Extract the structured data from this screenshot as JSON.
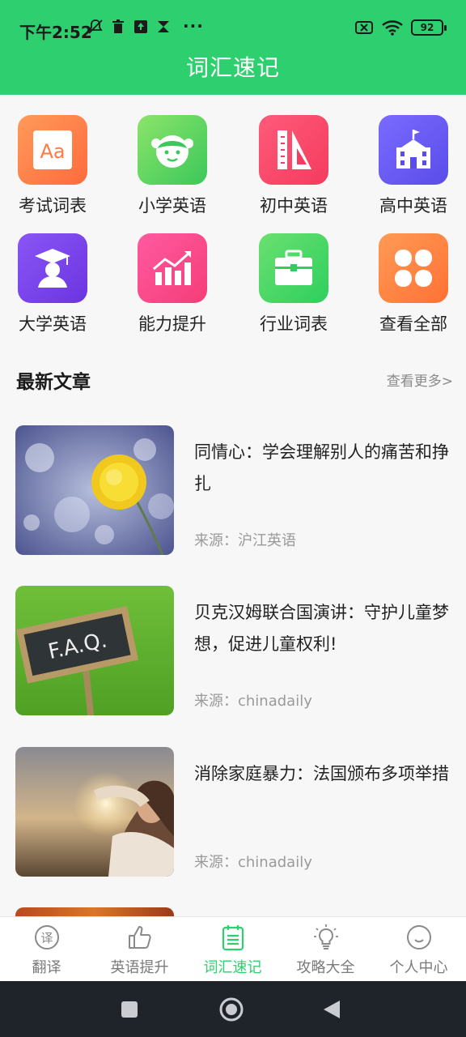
{
  "status": {
    "time": "下午2:52",
    "dots": "···",
    "battery": "92"
  },
  "header": {
    "title": "词汇速记"
  },
  "categories": [
    {
      "label": "考试词表",
      "icon": "aa-letters-icon",
      "color1": "#ff9a5a",
      "color2": "#ff6b3d"
    },
    {
      "label": "小学英语",
      "icon": "child-face-icon",
      "color1": "#8be46a",
      "color2": "#3cc85a"
    },
    {
      "label": "初中英语",
      "icon": "ruler-triangle-icon",
      "color1": "#ff5a7a",
      "color2": "#f43c5e"
    },
    {
      "label": "高中英语",
      "icon": "school-building-icon",
      "color1": "#7a6bff",
      "color2": "#5a4ce8"
    },
    {
      "label": "大学英语",
      "icon": "graduate-icon",
      "color1": "#8a55f5",
      "color2": "#6a35e0"
    },
    {
      "label": "能力提升",
      "icon": "growth-chart-icon",
      "color1": "#ff5aa0",
      "color2": "#f53d78"
    },
    {
      "label": "行业词表",
      "icon": "toolbox-icon",
      "color1": "#6ae070",
      "color2": "#2ecf5e"
    },
    {
      "label": "查看全部",
      "icon": "four-petal-icon",
      "color1": "#ff9a55",
      "color2": "#ff7235"
    }
  ],
  "section": {
    "title": "最新文章",
    "more": "查看更多>"
  },
  "articles": [
    {
      "title": "同情心：学会理解别人的痛苦和挣扎",
      "source": "来源：沪江英语"
    },
    {
      "title": "贝克汉姆联合国演讲：守护儿童梦想，促进儿童权利!",
      "source": "来源：chinadaily"
    },
    {
      "title": "消除家庭暴力：法国颁布多项举措",
      "source": "来源：chinadaily"
    }
  ],
  "thumb_faq_text": "F.A.Q.",
  "nav": [
    {
      "label": "翻译",
      "icon": "translate-icon"
    },
    {
      "label": "英语提升",
      "icon": "thumbs-up-icon"
    },
    {
      "label": "词汇速记",
      "icon": "notebook-icon",
      "active": true
    },
    {
      "label": "攻略大全",
      "icon": "lightbulb-icon"
    },
    {
      "label": "个人中心",
      "icon": "smiley-icon"
    }
  ],
  "colors": {
    "brand": "#2ecf6e",
    "page_bg": "#f7f7f7",
    "system_nav": "#1f242b"
  }
}
